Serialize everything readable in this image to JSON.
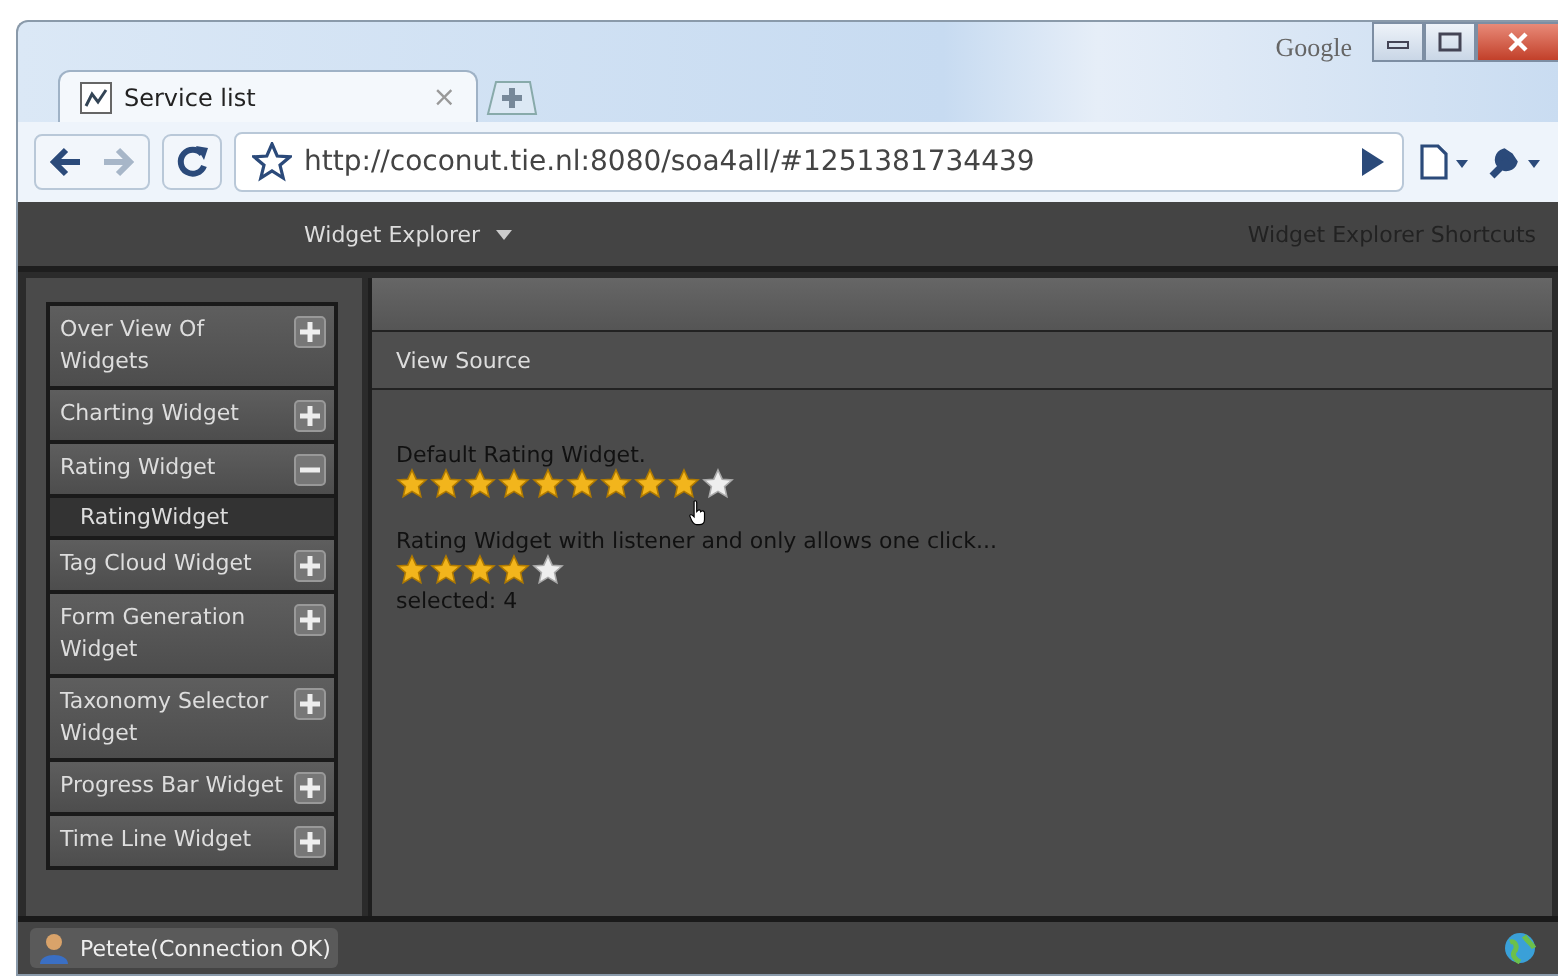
{
  "browser": {
    "brand": "Google",
    "tabs": [
      {
        "label": "Service list",
        "selected": true,
        "close": "×"
      }
    ],
    "url": "http://coconut.tie.nl:8080/soa4all/#1251381734439"
  },
  "menubar": {
    "menu": "Widget Explorer",
    "shortcuts": "Widget Explorer Shortcuts"
  },
  "sidebar": {
    "items": [
      {
        "label": "Over View Of Widgets",
        "expanded": false
      },
      {
        "label": "Charting Widget",
        "expanded": false
      },
      {
        "label": "Rating Widget",
        "expanded": true,
        "children": [
          {
            "label": "RatingWidget"
          }
        ]
      },
      {
        "label": "Tag Cloud Widget",
        "expanded": false
      },
      {
        "label": "Form Generation Widget",
        "expanded": false
      },
      {
        "label": "Taxonomy Selector Widget",
        "expanded": false
      },
      {
        "label": "Progress Bar Widget",
        "expanded": false
      },
      {
        "label": "Time Line Widget",
        "expanded": false
      }
    ]
  },
  "content": {
    "toolbar_link": "View Source",
    "ratings": [
      {
        "label": "Default Rating Widget.",
        "kind": "ten-star",
        "stars": 9
      },
      {
        "label": "Rating Widget with listener and only allows one click...",
        "kind": "five-star",
        "stars": 4,
        "note": "selected: 4"
      }
    ]
  },
  "status_bar": {
    "user": "Petete(Connection OK)"
  }
}
